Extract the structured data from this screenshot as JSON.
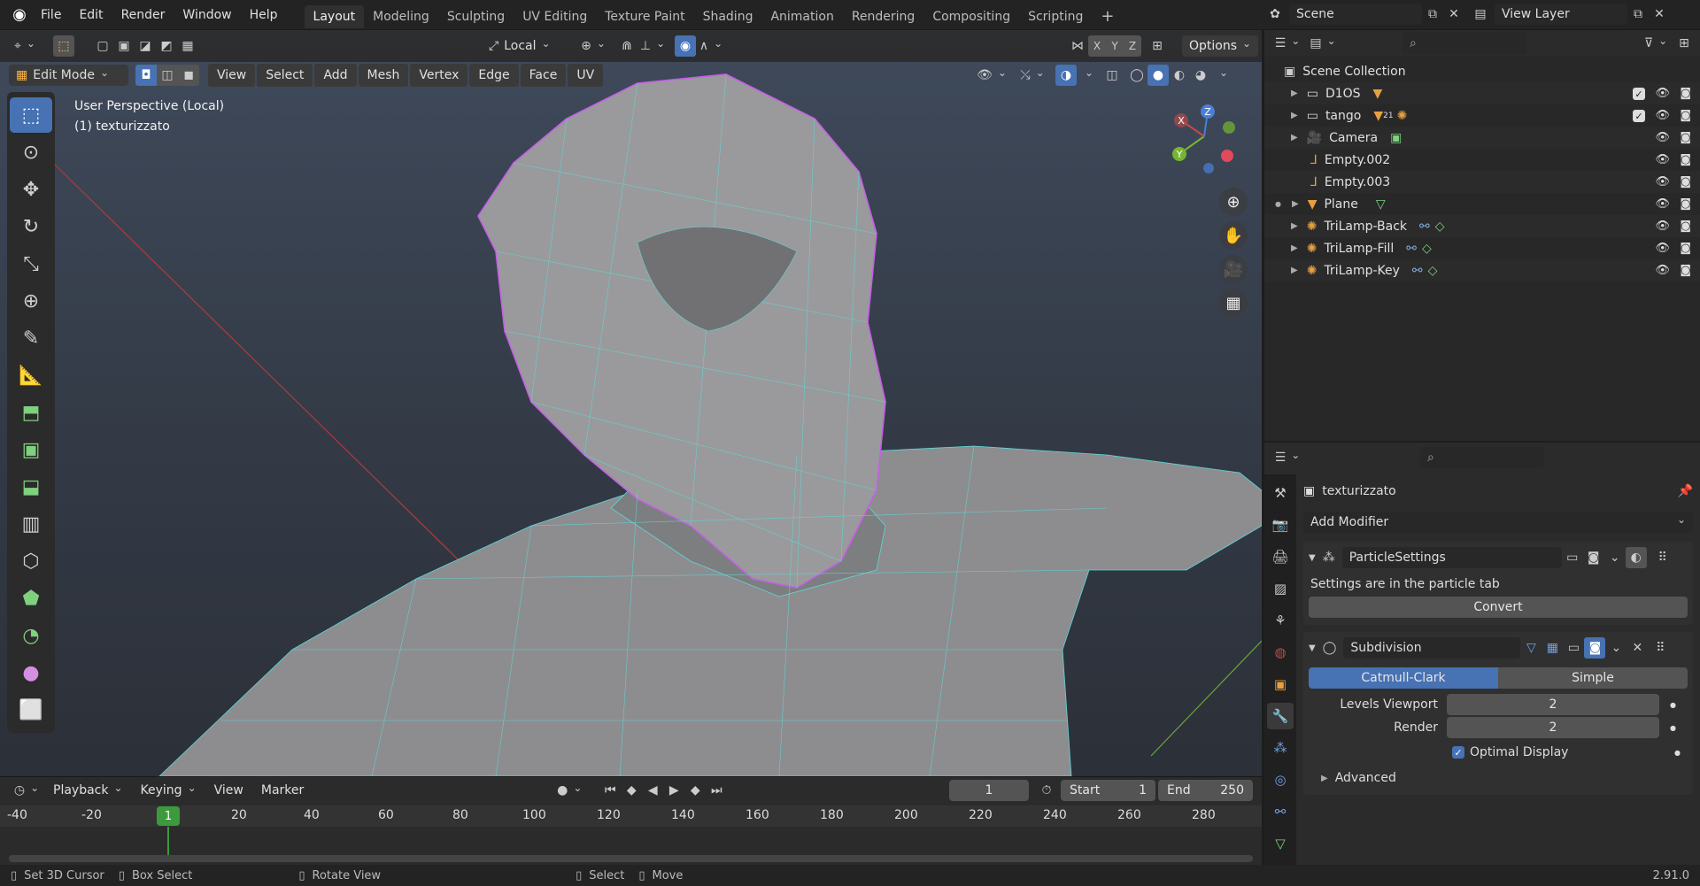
{
  "menu": {
    "file": "File",
    "edit": "Edit",
    "render": "Render",
    "window": "Window",
    "help": "Help"
  },
  "workspaces": [
    "Layout",
    "Modeling",
    "Sculpting",
    "UV Editing",
    "Texture Paint",
    "Shading",
    "Animation",
    "Rendering",
    "Compositing",
    "Scripting"
  ],
  "scene": {
    "label": "Scene",
    "view_layer": "View Layer"
  },
  "header": {
    "orientation": "Local",
    "options": "Options",
    "axes": [
      "X",
      "Y",
      "Z"
    ]
  },
  "mode": {
    "label": "Edit Mode",
    "menus": [
      "View",
      "Select",
      "Add",
      "Mesh",
      "Vertex",
      "Edge",
      "Face",
      "UV"
    ]
  },
  "viewport": {
    "perspective": "User Perspective (Local)",
    "object": "(1) texturizzato"
  },
  "gizmo": {
    "x": "X",
    "y": "Y",
    "z": "Z"
  },
  "outliner": {
    "title": "Scene Collection",
    "items": [
      {
        "name": "D1OS",
        "icon": "collection"
      },
      {
        "name": "tango",
        "icon": "collection",
        "badge": "21"
      },
      {
        "name": "Camera",
        "icon": "camera"
      },
      {
        "name": "Empty.002",
        "icon": "empty"
      },
      {
        "name": "Empty.003",
        "icon": "empty"
      },
      {
        "name": "Plane",
        "icon": "mesh"
      },
      {
        "name": "TriLamp-Back",
        "icon": "light"
      },
      {
        "name": "TriLamp-Fill",
        "icon": "light"
      },
      {
        "name": "TriLamp-Key",
        "icon": "light"
      }
    ]
  },
  "properties": {
    "object_name": "texturizzato",
    "add_modifier": "Add Modifier",
    "particle": {
      "name": "ParticleSettings",
      "info": "Settings are in the particle tab",
      "convert": "Convert"
    },
    "subdivision": {
      "name": "Subdivision",
      "catmull": "Catmull-Clark",
      "simple": "Simple",
      "levels_label": "Levels Viewport",
      "levels_value": "2",
      "render_label": "Render",
      "render_value": "2",
      "optimal": "Optimal Display",
      "advanced": "Advanced"
    }
  },
  "timeline": {
    "playback": "Playback",
    "keying": "Keying",
    "view": "View",
    "marker": "Marker",
    "current_frame": "1",
    "start_label": "Start",
    "start": "1",
    "end_label": "End",
    "end": "250",
    "ticks": [
      "-40",
      "-20",
      "20",
      "40",
      "60",
      "80",
      "100",
      "120",
      "140",
      "160",
      "180",
      "200",
      "220",
      "240",
      "260",
      "280"
    ],
    "cursor_frame": "1"
  },
  "status": {
    "set_cursor": "Set 3D Cursor",
    "box_select": "Box Select",
    "rotate": "Rotate View",
    "select": "Select",
    "move": "Move",
    "version": "2.91.0"
  },
  "colors": {
    "accent": "#4772b3",
    "wire": "#5fd8d8",
    "vertex": "#c55fe6",
    "orange": "#e6a041"
  }
}
